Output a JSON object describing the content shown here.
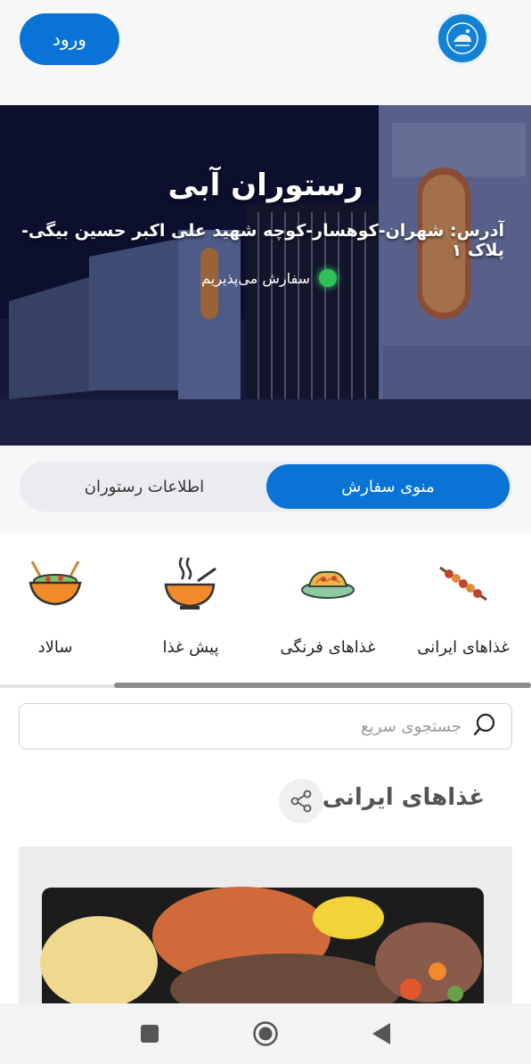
{
  "header": {
    "login_label": "ورود"
  },
  "hero": {
    "title": "رستوران آبی",
    "address": "آدرس: شهران-کوهسار-کوچه شهید علی اکبر حسین بیگی-پلاک ۱",
    "status": "سفارش می‌پذیریم"
  },
  "tabs": {
    "menu": "منوی سفارش",
    "info": "اطلاعات رستوران"
  },
  "categories": [
    {
      "label": "غذاهای ایرانی",
      "icon": "kebab-icon"
    },
    {
      "label": "غذاهای فرنگی",
      "icon": "pasta-icon"
    },
    {
      "label": "پیش غذا",
      "icon": "soup-icon"
    },
    {
      "label": "سالاد",
      "icon": "salad-icon"
    }
  ],
  "search": {
    "placeholder": "جستجوی سریع"
  },
  "section": {
    "title": "غذاهای ایرانی"
  },
  "colors": {
    "accent": "#0a74d6",
    "status": "#2fc05a"
  }
}
